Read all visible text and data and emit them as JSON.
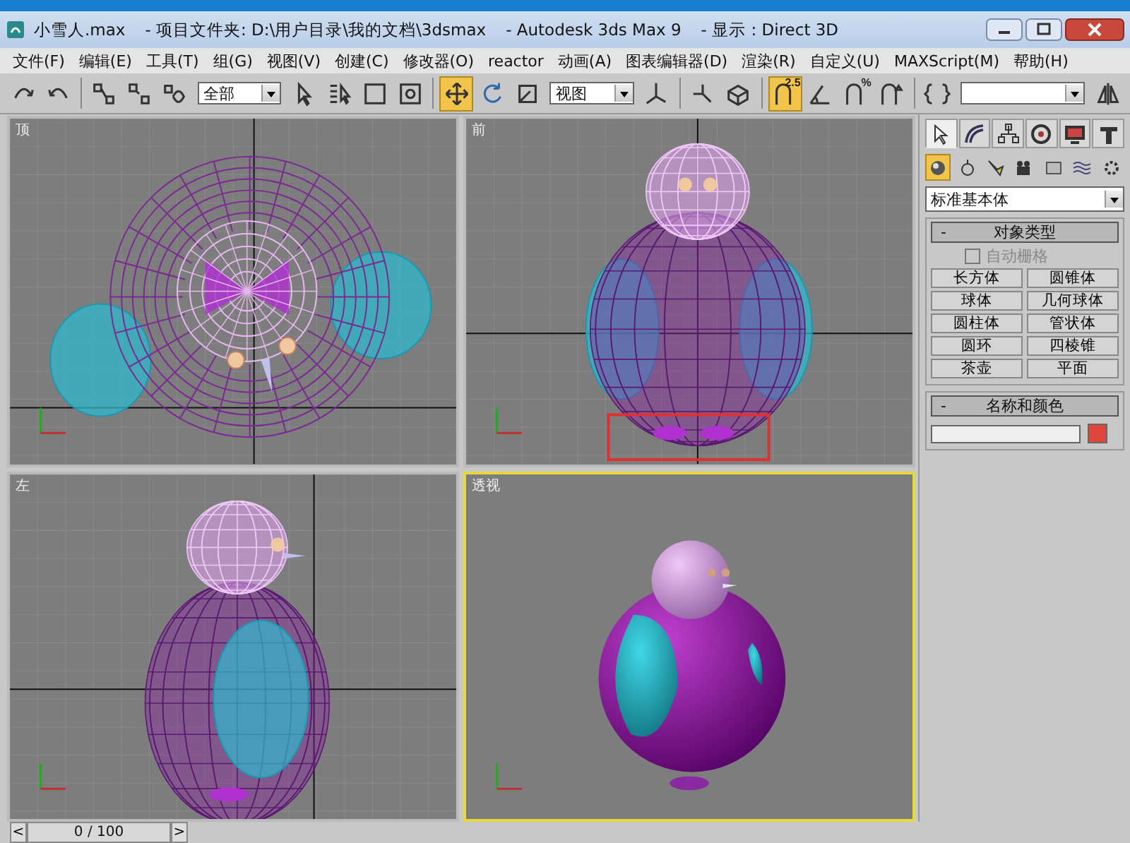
{
  "window": {
    "title_parts": [
      "小雪人.max",
      "- 项目文件夹: D:\\用户目录\\我的文档\\3dsmax",
      "- Autodesk 3ds Max 9",
      "- 显示 : Direct 3D"
    ]
  },
  "menu": [
    "文件(F)",
    "编辑(E)",
    "工具(T)",
    "组(G)",
    "视图(V)",
    "创建(C)",
    "修改器(O)",
    "reactor",
    "动画(A)",
    "图表编辑器(D)",
    "渲染(R)",
    "自定义(U)",
    "MAXScript(M)",
    "帮助(H)"
  ],
  "toolbar": [
    {
      "kind": "button",
      "selected": false
    },
    {
      "kind": "button",
      "selected": false
    },
    {
      "kind": "sep"
    },
    {
      "kind": "button",
      "selected": false
    },
    {
      "kind": "button",
      "selected": false
    },
    {
      "kind": "button",
      "selected": false
    },
    {
      "kind": "dropdown",
      "value": "全部"
    },
    {
      "kind": "button",
      "selected": false
    },
    {
      "kind": "button",
      "selected": false
    },
    {
      "kind": "button",
      "selected": false
    },
    {
      "kind": "button",
      "selected": false
    },
    {
      "kind": "sep"
    },
    {
      "kind": "button",
      "selected": true
    },
    {
      "kind": "button",
      "selected": false
    },
    {
      "kind": "button",
      "selected": false
    },
    {
      "kind": "dropdown",
      "value": "视图"
    },
    {
      "kind": "button",
      "selected": false
    },
    {
      "kind": "sep"
    },
    {
      "kind": "button",
      "selected": false
    },
    {
      "kind": "button",
      "selected": false
    },
    {
      "kind": "sep"
    },
    {
      "kind": "button",
      "selected": true,
      "label": "2.5"
    },
    {
      "kind": "button",
      "selected": false
    },
    {
      "kind": "button",
      "selected": false,
      "label": "%"
    },
    {
      "kind": "button",
      "selected": false
    },
    {
      "kind": "sep"
    },
    {
      "kind": "button",
      "selected": false
    },
    {
      "kind": "dropdown"
    },
    {
      "kind": "button",
      "selected": false
    }
  ],
  "viewports": [
    {
      "label": "顶",
      "kind": "top",
      "active": false,
      "highlight": false
    },
    {
      "label": "前",
      "kind": "front",
      "active": false,
      "highlight": true
    },
    {
      "label": "左",
      "kind": "left",
      "active": false,
      "highlight": false
    },
    {
      "label": "透视",
      "kind": "perspective",
      "active": true,
      "highlight": false
    }
  ],
  "command_panel": {
    "tabs": [
      {
        "selected": true
      },
      {
        "selected": false
      },
      {
        "selected": false
      },
      {
        "selected": false
      },
      {
        "selected": false
      },
      {
        "selected": false
      }
    ],
    "categories": [
      {
        "selected": true
      },
      {
        "selected": false
      },
      {
        "selected": false
      },
      {
        "selected": false
      },
      {
        "selected": false
      },
      {
        "selected": false
      },
      {
        "selected": false
      }
    ],
    "dropdown": "标准基本体",
    "rollouts": [
      {
        "kind": "object_type",
        "title": "对象类型",
        "collapse": "-",
        "checkbox": {
          "label": "自动栅格",
          "checked": false,
          "disabled": true
        },
        "buttons": [
          "长方体",
          "圆锥体",
          "球体",
          "几何球体",
          "圆柱体",
          "管状体",
          "圆环",
          "四棱锥",
          "茶壶",
          "平面"
        ]
      },
      {
        "kind": "name_color",
        "title": "名称和颜色",
        "collapse": "-",
        "color": "#e0473b"
      }
    ]
  },
  "timeline": {
    "prev": "<",
    "position": "0 / 100",
    "level": 0,
    "next": ">"
  }
}
